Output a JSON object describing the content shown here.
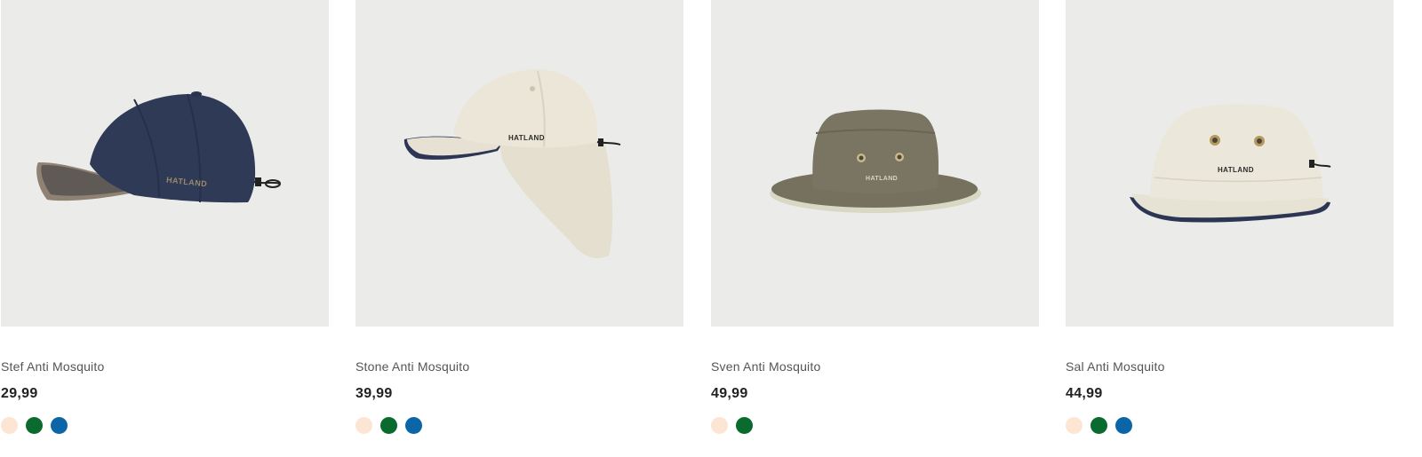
{
  "products": [
    {
      "name": "Stef Anti Mosquito",
      "price": "29,99",
      "image_icon": "navy-baseball-cap-icon",
      "brand_mark": "HATLAND",
      "swatches": [
        "#fde5d3",
        "#0a6b2e",
        "#0b65a6"
      ]
    },
    {
      "name": "Stone Anti Mosquito",
      "price": "39,99",
      "image_icon": "beige-cap-with-neck-flap-icon",
      "brand_mark": "HATLAND",
      "swatches": [
        "#fde5d3",
        "#0a6b2e",
        "#0b65a6"
      ]
    },
    {
      "name": "Sven Anti Mosquito",
      "price": "49,99",
      "image_icon": "olive-bush-hat-icon",
      "brand_mark": "HATLAND",
      "swatches": [
        "#fde5d3",
        "#0a6b2e"
      ]
    },
    {
      "name": "Sal Anti Mosquito",
      "price": "44,99",
      "image_icon": "beige-bucket-hat-icon",
      "brand_mark": "HATLAND",
      "swatches": [
        "#fde5d3",
        "#0a6b2e",
        "#0b65a6"
      ]
    }
  ]
}
